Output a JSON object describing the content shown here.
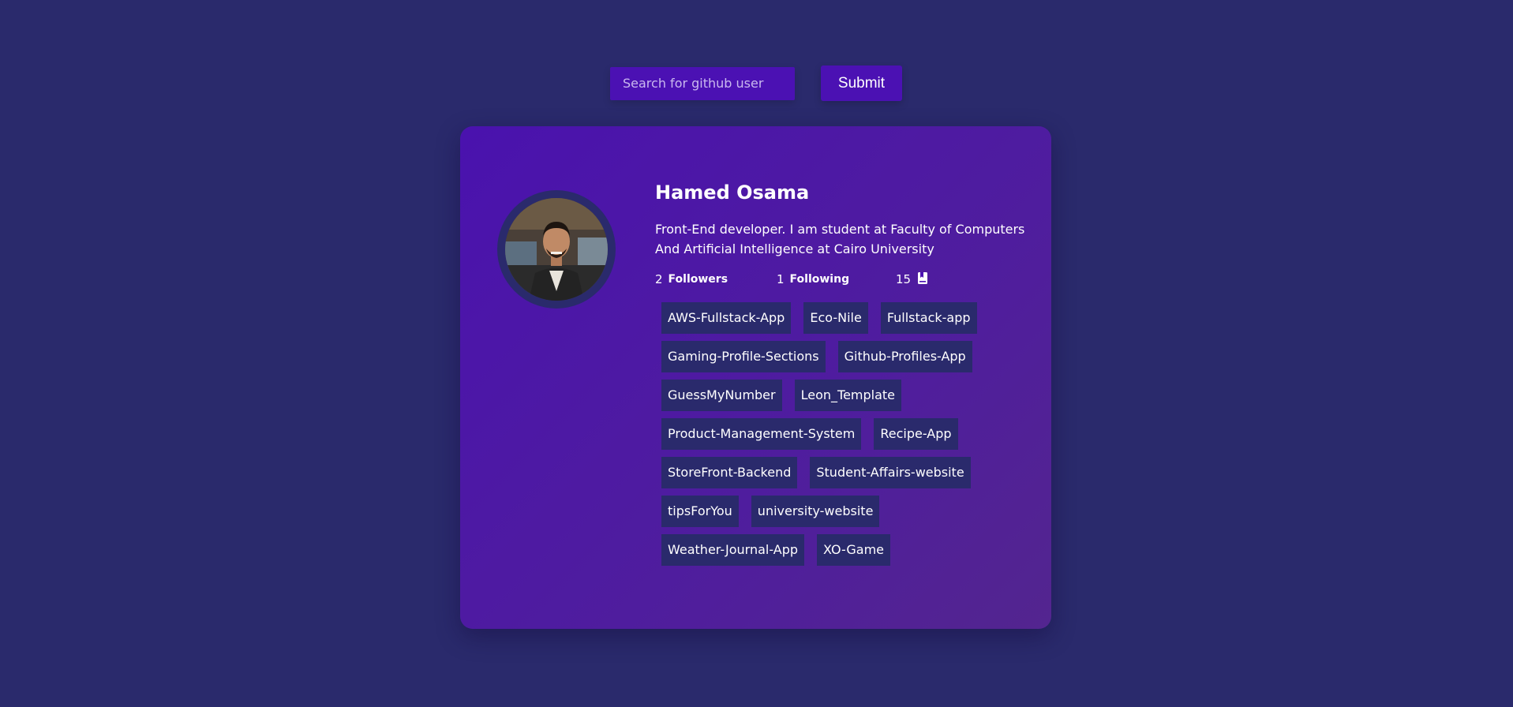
{
  "search": {
    "placeholder": "Search for github user",
    "value": "",
    "submit_label": "Submit"
  },
  "profile": {
    "name": "Hamed Osama",
    "bio": "Front-End developer. I am student at Faculty of Computers And Artificial Intelligence at Cairo University",
    "followers_count": "2",
    "followers_label": "Followers",
    "following_count": "1",
    "following_label": "Following",
    "repos_count": "15",
    "repos_icon": "bookmark-icon",
    "repos": [
      "AWS-Fullstack-App",
      "Eco-Nile",
      "Fullstack-app",
      "Gaming-Profile-Sections",
      "Github-Profiles-App",
      "GuessMyNumber",
      "Leon_Template",
      "Product-Management-System",
      "Recipe-App",
      "StoreFront-Backend",
      "Student-Affairs-website",
      "tipsForYou",
      "university-website",
      "Weather-Journal-App",
      "XO-Game"
    ]
  },
  "colors": {
    "background": "#2a2a6c",
    "accent": "#4b11b3",
    "card_gradient_start": "#4a12ae",
    "card_gradient_end": "#53258f",
    "tag_background": "#2a2a6c"
  }
}
